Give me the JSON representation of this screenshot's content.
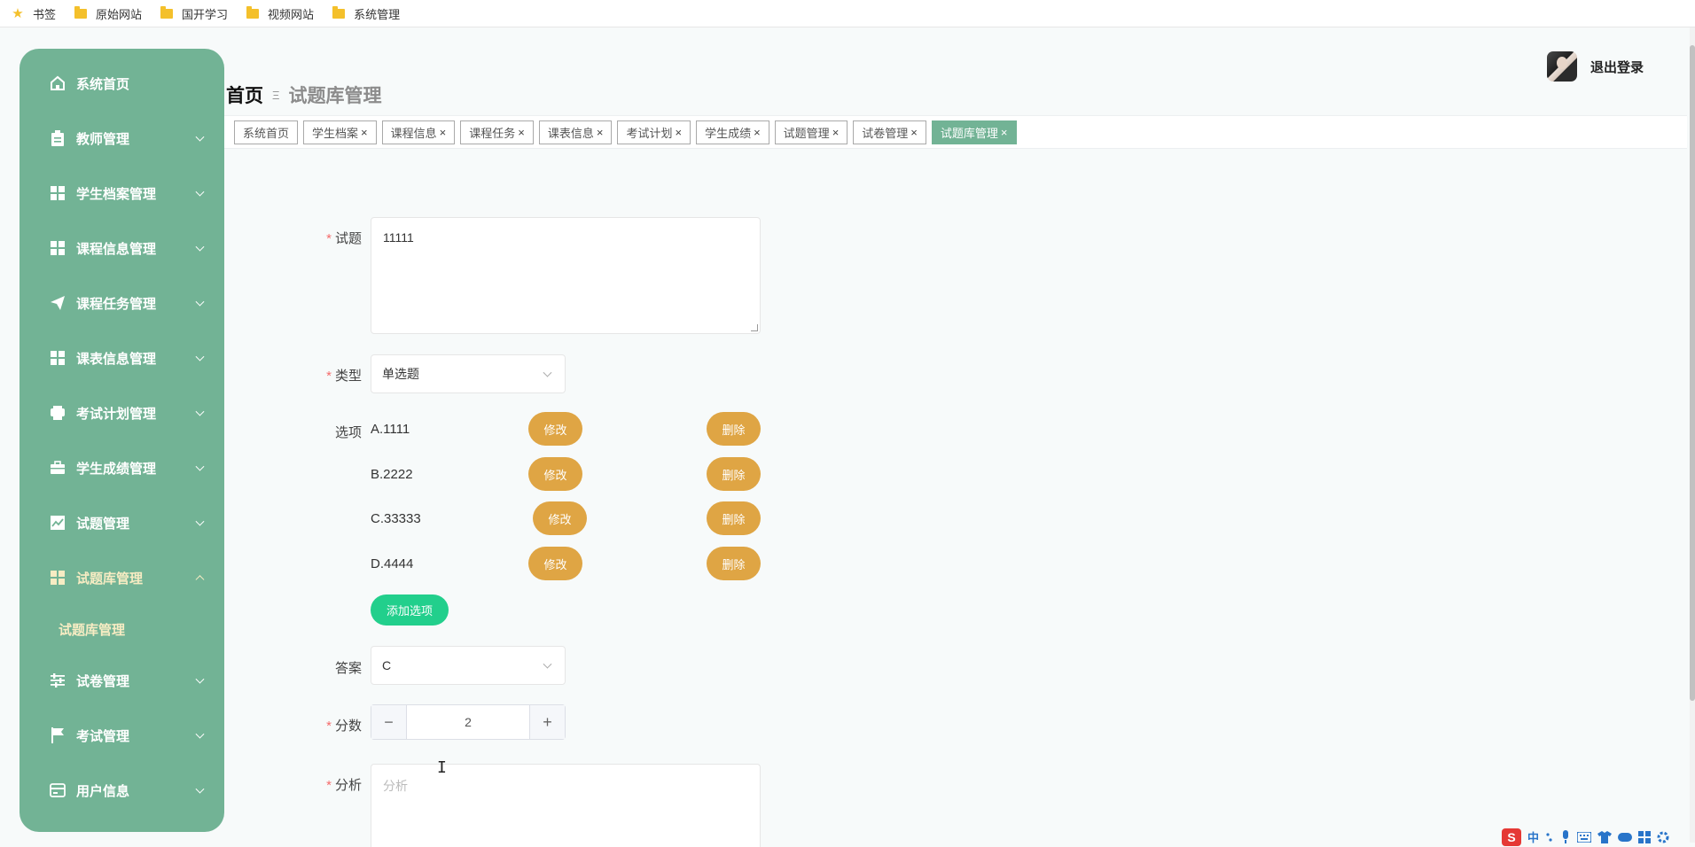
{
  "bookmarks": [
    {
      "label": "书签",
      "icon": "star-icon"
    },
    {
      "label": "原始网站",
      "icon": "folder-icon"
    },
    {
      "label": "国开学习",
      "icon": "folder-icon"
    },
    {
      "label": "视频网站",
      "icon": "folder-icon"
    },
    {
      "label": "系统管理",
      "icon": "folder-icon"
    }
  ],
  "sidebar": {
    "items": [
      {
        "label": "系统首页",
        "icon": "home-icon"
      },
      {
        "label": "教师管理",
        "icon": "clipboard-icon"
      },
      {
        "label": "学生档案管理",
        "icon": "grid-icon"
      },
      {
        "label": "课程信息管理",
        "icon": "grid-icon"
      },
      {
        "label": "课程任务管理",
        "icon": "send-icon"
      },
      {
        "label": "课表信息管理",
        "icon": "grid-icon"
      },
      {
        "label": "考试计划管理",
        "icon": "printer-icon"
      },
      {
        "label": "学生成绩管理",
        "icon": "briefcase-icon"
      },
      {
        "label": "试题管理",
        "icon": "chart-icon"
      },
      {
        "label": "试题库管理",
        "icon": "grid-icon"
      },
      {
        "label": "试卷管理",
        "icon": "sliders-icon"
      },
      {
        "label": "考试管理",
        "icon": "flag-icon"
      },
      {
        "label": "用户信息",
        "icon": "card-icon"
      }
    ],
    "submenu_label": "试题库管理",
    "active_color": "#f7ecc3",
    "bg_color": "#72b395"
  },
  "header": {
    "breadcrumb_home": "首页",
    "breadcrumb_sep": "Ξ",
    "breadcrumb_current": "试题库管理",
    "logout_label": "退出登录"
  },
  "tabs": [
    {
      "label": "系统首页",
      "closable": false
    },
    {
      "label": "学生档案",
      "closable": true
    },
    {
      "label": "课程信息",
      "closable": true
    },
    {
      "label": "课程任务",
      "closable": true
    },
    {
      "label": "课表信息",
      "closable": true
    },
    {
      "label": "考试计划",
      "closable": true
    },
    {
      "label": "学生成绩",
      "closable": true
    },
    {
      "label": "试题管理",
      "closable": true
    },
    {
      "label": "试卷管理",
      "closable": true
    },
    {
      "label": "试题库管理",
      "closable": true,
      "active": true
    }
  ],
  "form": {
    "question_label": "试题",
    "question_value": "11111",
    "type_label": "类型",
    "type_value": "单选题",
    "options_label": "选项",
    "options": [
      {
        "text": "A.1111"
      },
      {
        "text": "B.2222"
      },
      {
        "text": "C.33333"
      },
      {
        "text": "D.4444"
      }
    ],
    "edit_label": "修改",
    "delete_label": "删除",
    "add_option_label": "添加选项",
    "answer_label": "答案",
    "answer_value": "C",
    "score_label": "分数",
    "score_value": "2",
    "analysis_label": "分析",
    "analysis_placeholder": "分析",
    "required_mark": "*"
  },
  "ime": {
    "logo": "S",
    "mode": "中"
  }
}
